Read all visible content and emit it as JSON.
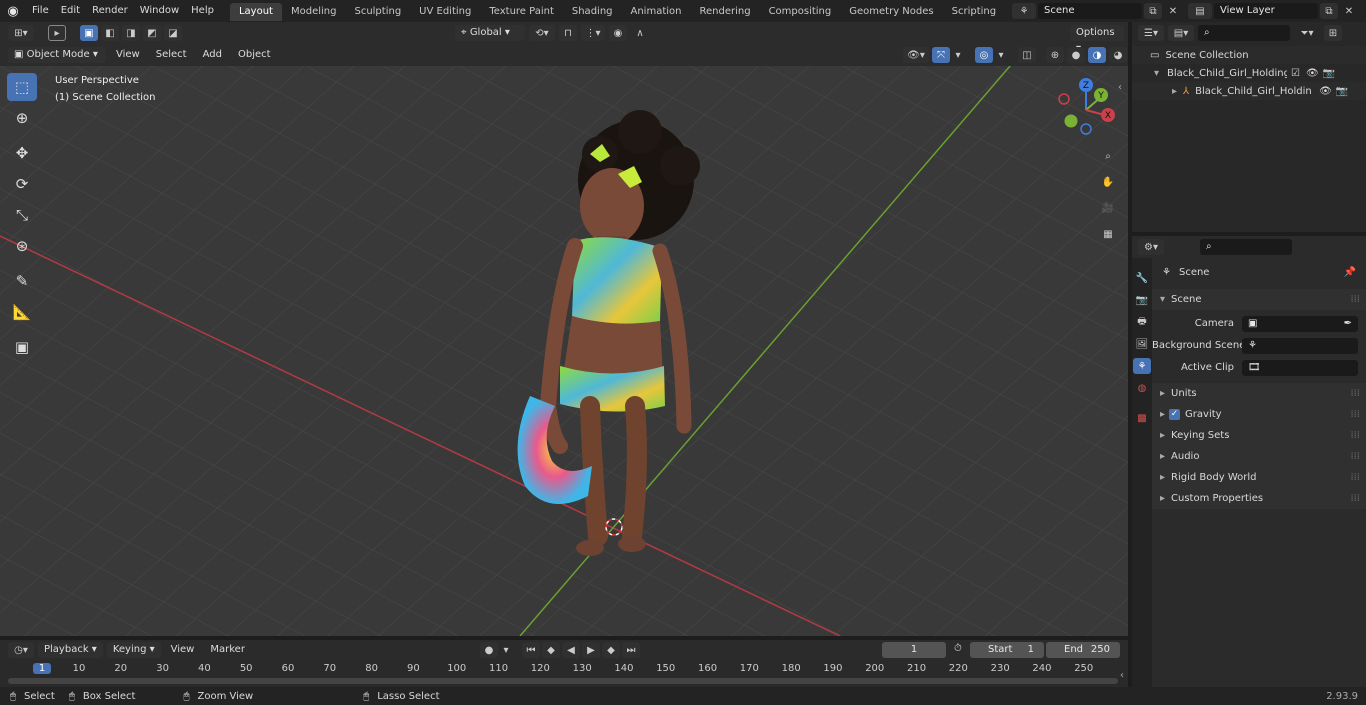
{
  "topbar": {
    "menus": [
      "File",
      "Edit",
      "Render",
      "Window",
      "Help"
    ],
    "workspaces": [
      "Layout",
      "Modeling",
      "Sculpting",
      "UV Editing",
      "Texture Paint",
      "Shading",
      "Animation",
      "Rendering",
      "Compositing",
      "Geometry Nodes",
      "Scripting"
    ],
    "active_workspace": "Layout",
    "add_tab": "+",
    "scene_name": "Scene",
    "view_layer": "View Layer"
  },
  "viewport_header": {
    "mode": "Object Mode",
    "menus": [
      "View",
      "Select",
      "Add",
      "Object"
    ],
    "transform_orientation": "Global",
    "options": "Options"
  },
  "viewport": {
    "perspective": "User Perspective",
    "collection": "(1) Scene Collection",
    "gizmo": {
      "z": "Z",
      "y": "Y",
      "x": "X"
    }
  },
  "outliner": {
    "root": "Scene Collection",
    "items": [
      {
        "label": "Black_Child_Girl_Holding_Swim"
      },
      {
        "label": "Black_Child_Girl_Holding_"
      }
    ]
  },
  "properties": {
    "context_title": "Scene",
    "panel_title": "Scene",
    "fields": [
      {
        "label": "Camera"
      },
      {
        "label": "Background Scene"
      },
      {
        "label": "Active Clip"
      }
    ],
    "sections": [
      "Units",
      "Gravity",
      "Keying Sets",
      "Audio",
      "Rigid Body World",
      "Custom Properties"
    ]
  },
  "timeline": {
    "menus": [
      "Playback",
      "Keying",
      "View",
      "Marker"
    ],
    "current_frame": "1",
    "start_label": "Start",
    "start": "1",
    "end_label": "End",
    "end": "250",
    "ticks": [
      "1",
      "10",
      "20",
      "30",
      "40",
      "50",
      "60",
      "70",
      "80",
      "90",
      "100",
      "110",
      "120",
      "130",
      "140",
      "150",
      "160",
      "170",
      "180",
      "190",
      "200",
      "210",
      "220",
      "230",
      "240",
      "250"
    ]
  },
  "statusbar": {
    "select": "Select",
    "box_select": "Box Select",
    "zoom_view": "Zoom View",
    "lasso_select": "Lasso Select",
    "version": "2.93.9"
  },
  "colors": {
    "accent": "#4772b3",
    "x_axis": "#c8414b",
    "y_axis": "#7ab236",
    "z_axis": "#3f7de0"
  }
}
